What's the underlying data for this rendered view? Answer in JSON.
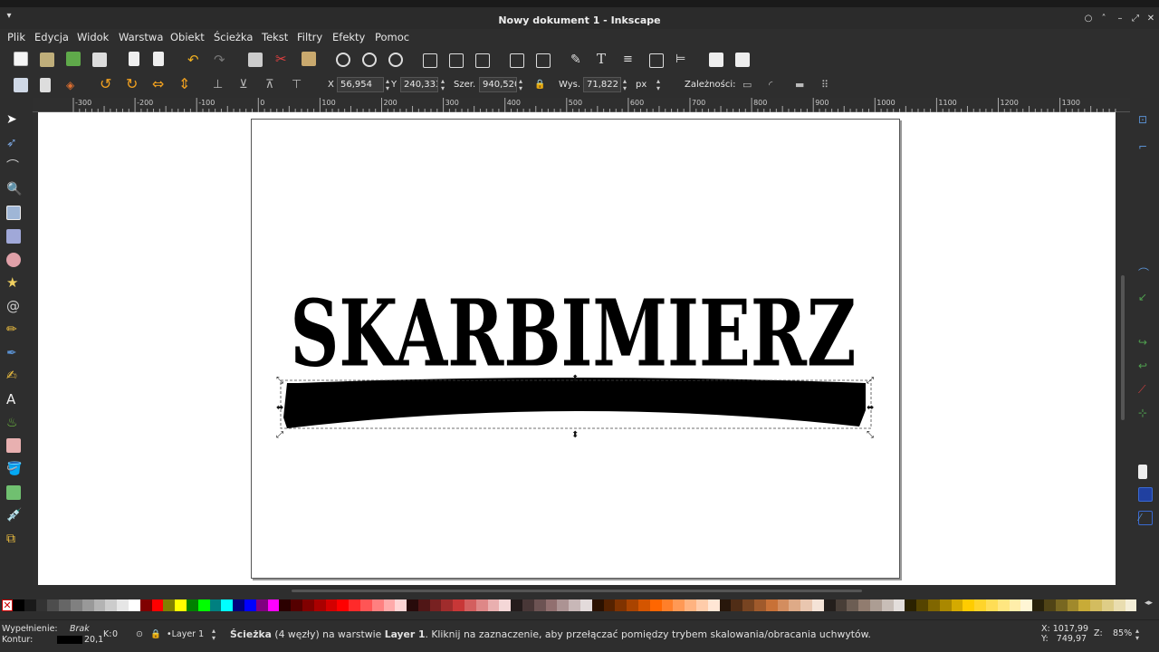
{
  "window": {
    "title": "Nowy dokument 1 - Inkscape"
  },
  "menu": [
    "Plik",
    "Edycja",
    "Widok",
    "Warstwa",
    "Obiekt",
    "Ścieżka",
    "Tekst",
    "Filtry",
    "Efekty",
    "Pomoc"
  ],
  "controls": {
    "x_label": "X",
    "x_value": "56,954",
    "y_label": "Y",
    "y_value": "240,333",
    "w_label": "Szer.",
    "w_value": "940,520",
    "h_label": "Wys.",
    "h_value": "71,822",
    "unit": "px",
    "deps_label": "Zależności:"
  },
  "ruler": {
    "top_labels": [
      "-300",
      "-200",
      "-100",
      "0",
      "100",
      "200",
      "300",
      "400",
      "500",
      "600",
      "700",
      "800",
      "900",
      "1000",
      "1100",
      "1200",
      "1300"
    ]
  },
  "canvas": {
    "artwork_text": "SKARBIMIERZ"
  },
  "status": {
    "fill_label": "Wypełnienie:",
    "fill_value": "Brak",
    "stroke_label": "Kontur:",
    "stroke_width": "20,1",
    "opacity_label": "K:",
    "opacity_value": "0",
    "layer": "•Layer 1",
    "message_bold": "Ścieżka",
    "message_mid": " (4 węzły) na warstwie ",
    "message_layer": "Layer 1",
    "message_end": ". Kliknij na zaznaczenie, aby przełączać pomiędzy trybem skalowania/obracania uchwytów.",
    "cursor_x": "X: 1017,99",
    "cursor_y": "Y:   749,97",
    "zoom_label": "Z:",
    "zoom_value": "85%"
  },
  "palette_colors": [
    "#000000",
    "#1a1a1a",
    "#333333",
    "#4d4d4d",
    "#666666",
    "#808080",
    "#999999",
    "#b3b3b3",
    "#cccccc",
    "#e6e6e6",
    "#ffffff",
    "#800000",
    "#ff0000",
    "#808000",
    "#ffff00",
    "#008000",
    "#00ff00",
    "#008080",
    "#00ffff",
    "#000080",
    "#0000ff",
    "#800080",
    "#ff00ff",
    "#2b0000",
    "#550000",
    "#800000",
    "#aa0000",
    "#d40000",
    "#ff0000",
    "#ff2a2a",
    "#ff5555",
    "#ff8080",
    "#ffaaaa",
    "#ffd5d5",
    "#280b0b",
    "#501616",
    "#782121",
    "#a02c2c",
    "#c83737",
    "#d35f5f",
    "#de8787",
    "#e9afaf",
    "#f4d7d7",
    "#241c1c",
    "#483737",
    "#6c5353",
    "#916f6f",
    "#ac9393",
    "#c8b7b7",
    "#e3dbdb",
    "#2b1100",
    "#552200",
    "#803300",
    "#aa4400",
    "#d45500",
    "#ff6600",
    "#ff7f2a",
    "#ff9955",
    "#ffb380",
    "#ffccaa",
    "#ffe6d5",
    "#28170b",
    "#502d16",
    "#784421",
    "#a05a2c",
    "#c87137",
    "#d38d5f",
    "#deaa87",
    "#e9c6af",
    "#f4e3d7",
    "#241f1c",
    "#483e37",
    "#6c5d53",
    "#917c6f",
    "#ac9d93",
    "#c8beb7",
    "#e3dedb",
    "#2b2200",
    "#554400",
    "#806600",
    "#aa8800",
    "#d4aa00",
    "#ffcc00",
    "#ffd42a",
    "#ffdd55",
    "#ffe680",
    "#ffeeaa",
    "#fff6d5",
    "#28220b",
    "#504416",
    "#786721",
    "#a0892c",
    "#c8ab37",
    "#d3bc5f",
    "#decd87",
    "#e9ddaf",
    "#f4eed7"
  ]
}
